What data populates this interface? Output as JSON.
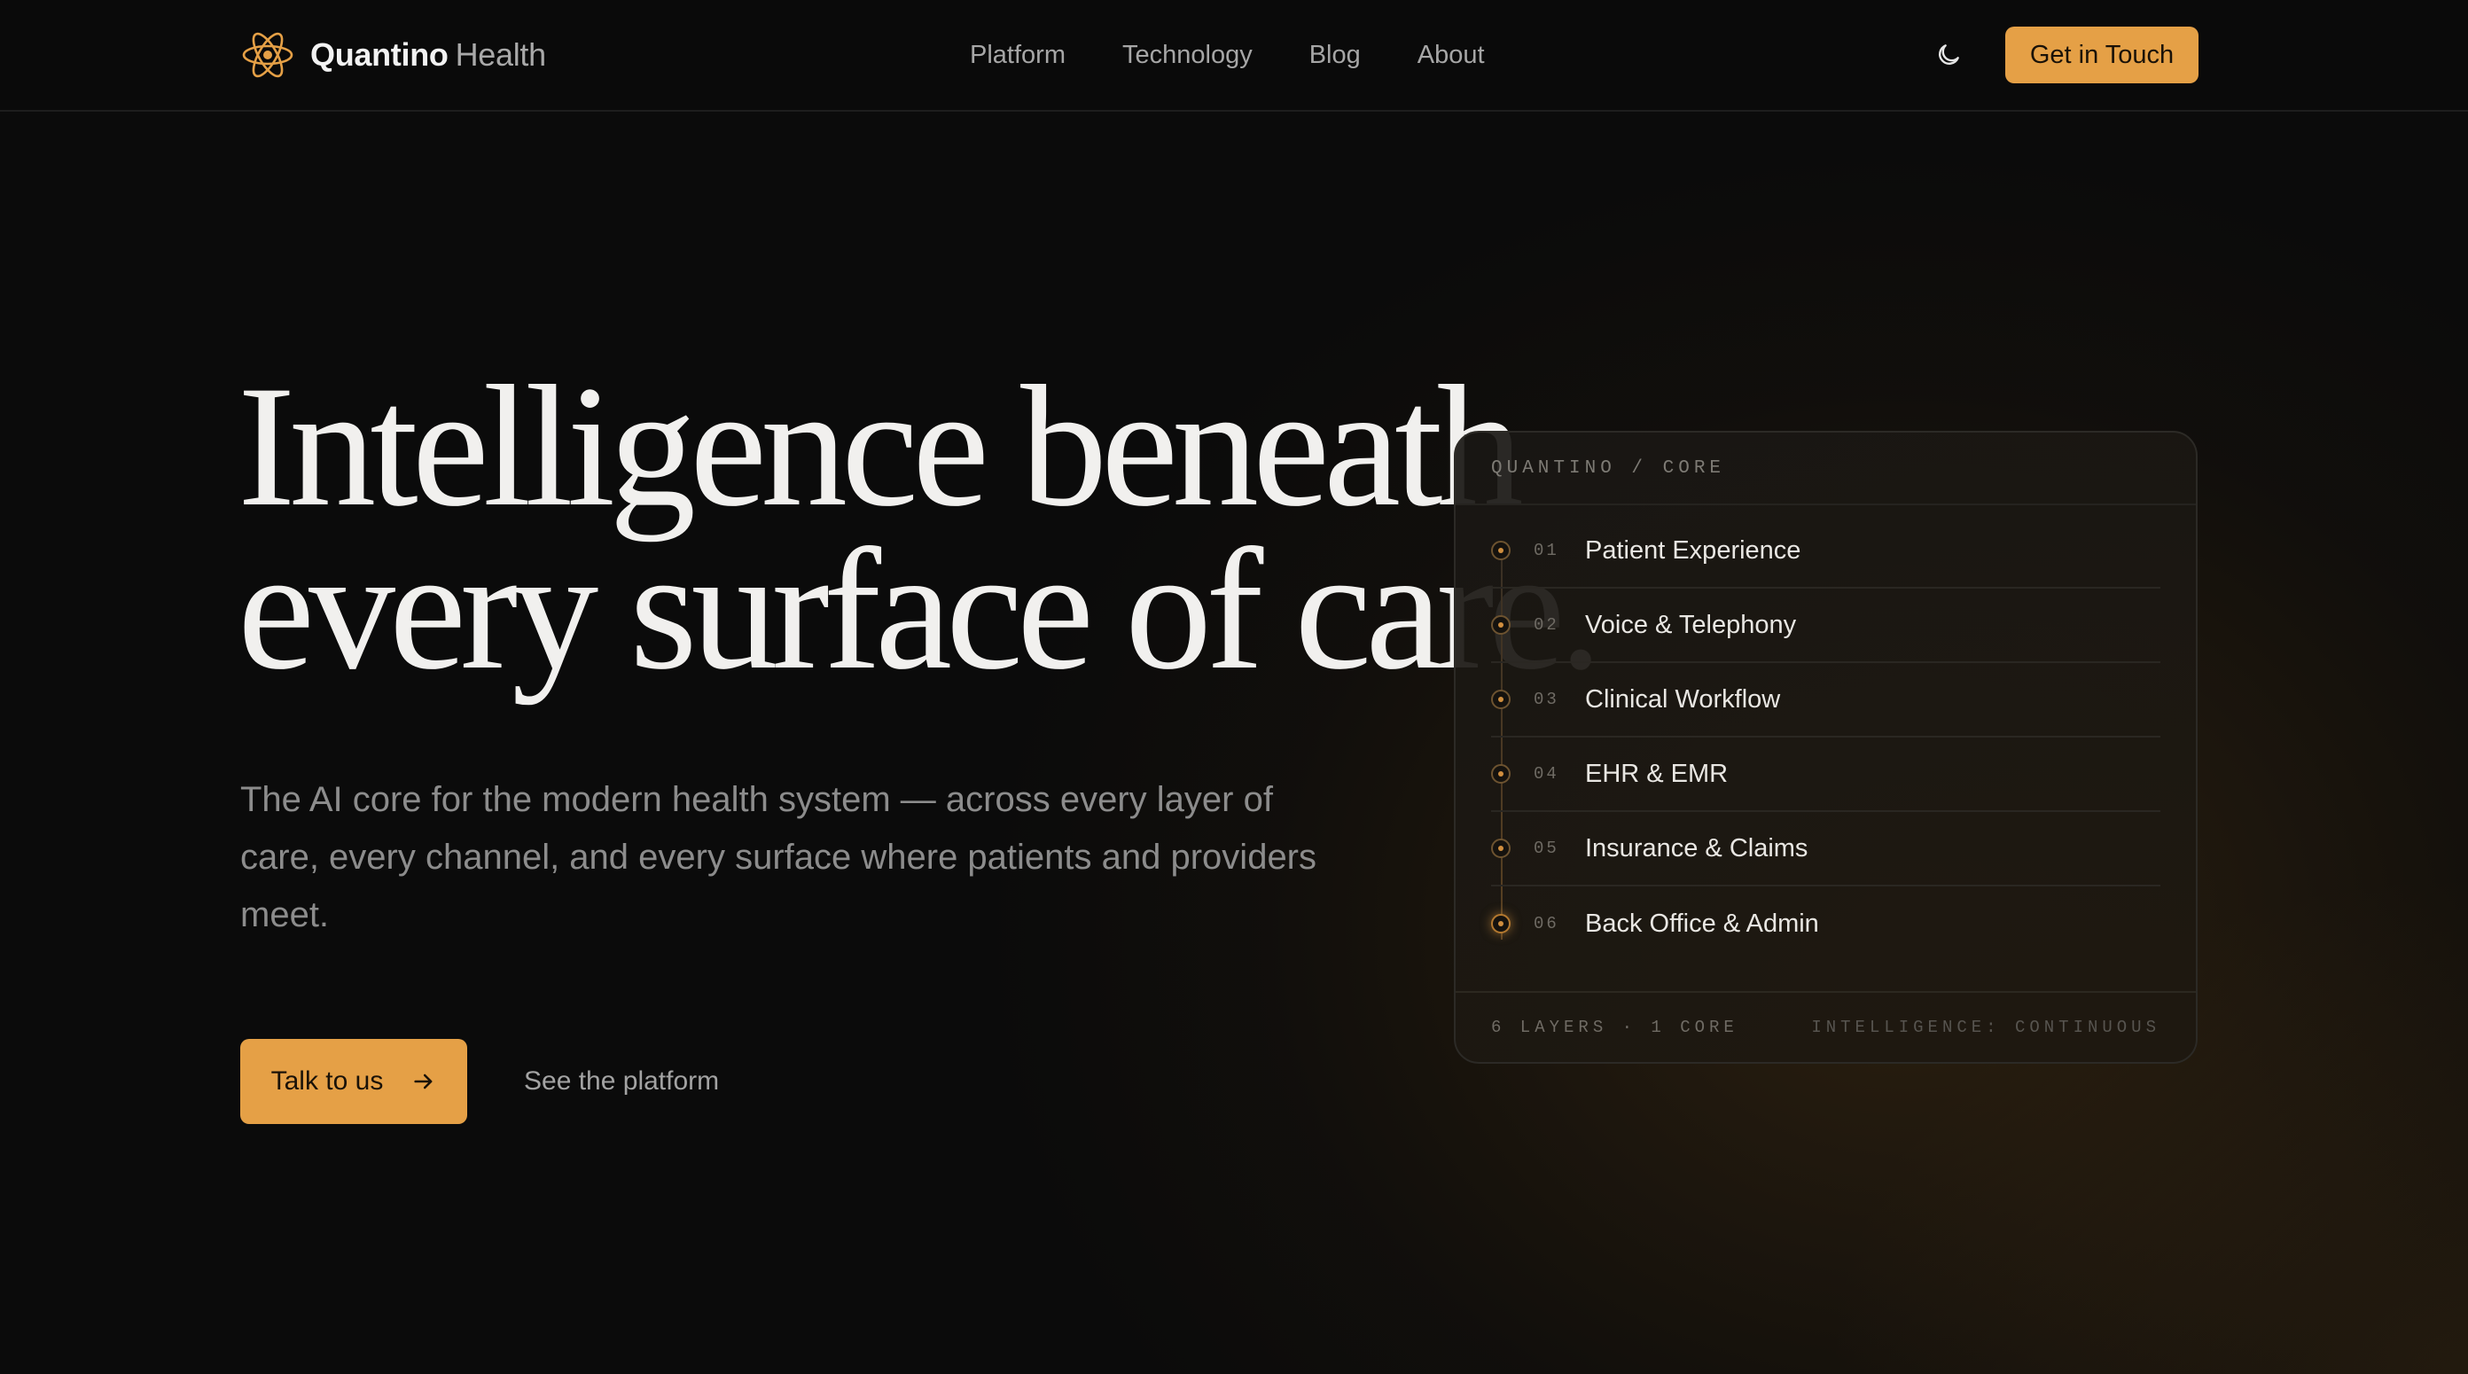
{
  "brand": {
    "name_bold": "Quantino",
    "name_light": "Health",
    "icon": "atom-logo-icon",
    "accent": "#e5a046"
  },
  "nav": [
    {
      "label": "Platform"
    },
    {
      "label": "Technology"
    },
    {
      "label": "Blog"
    },
    {
      "label": "About"
    }
  ],
  "header": {
    "theme_icon": "moon-icon",
    "cta_label": "Get in Touch"
  },
  "hero": {
    "headline_line1": "Intelligence beneath",
    "headline_line2": "every surface of care.",
    "subtext": "The AI core for the modern health system — across every layer of care, every channel, and every surface where patients and providers meet.",
    "primary_cta": "Talk to us",
    "primary_cta_icon": "arrow-right-icon",
    "secondary_cta": "See the platform"
  },
  "core_card": {
    "title": "QUANTINO / CORE",
    "layers": [
      {
        "num": "01",
        "label": "Patient Experience"
      },
      {
        "num": "02",
        "label": "Voice & Telephony"
      },
      {
        "num": "03",
        "label": "Clinical Workflow"
      },
      {
        "num": "04",
        "label": "EHR & EMR"
      },
      {
        "num": "05",
        "label": "Insurance & Claims"
      },
      {
        "num": "06",
        "label": "Back Office & Admin"
      }
    ],
    "footer_left": "6 LAYERS · 1 CORE",
    "footer_right": "INTELLIGENCE: CONTINUOUS"
  }
}
